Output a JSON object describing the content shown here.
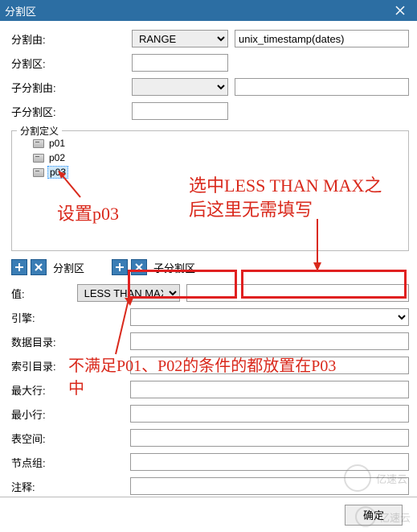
{
  "title": "分割区",
  "top_form": {
    "partition_by_label": "分割由:",
    "partition_by_value": "RANGE",
    "partition_expr": "unix_timestamp(dates)",
    "partition_zone_label": "分割区:",
    "partition_zone_value": "",
    "sub_partition_by_label": "子分割由:",
    "sub_partition_by_value": "",
    "sub_partition_expr": "",
    "sub_partition_zone_label": "子分割区:",
    "sub_partition_zone_value": ""
  },
  "definition_legend": "分割定义",
  "tree_items": [
    {
      "label": "p01",
      "selected": false
    },
    {
      "label": "p02",
      "selected": false
    },
    {
      "label": "p03",
      "selected": true
    }
  ],
  "annotations": {
    "a1": "设置p03",
    "a2": "选中LESS THAN MAX之后这里无需填写",
    "a3": "不满足P01、P02的条件的都放置在P03中"
  },
  "icons_row": {
    "section1_label": "分割区",
    "section2_label": "子分割区"
  },
  "detail_form": {
    "value_label": "值:",
    "value_select": "LESS THAN MAX",
    "value_extra": "",
    "engine_label": "引擎:",
    "engine_value": "",
    "data_dir_label": "数据目录:",
    "data_dir_value": "",
    "index_dir_label": "索引目录:",
    "index_dir_value": "",
    "max_rows_label": "最大行:",
    "max_rows_value": "",
    "min_rows_label": "最小行:",
    "min_rows_value": "",
    "tablespace_label": "表空间:",
    "tablespace_value": "",
    "nodegroup_label": "节点组:",
    "nodegroup_value": "",
    "comment_label": "注释:",
    "comment_value": ""
  },
  "buttons": {
    "ok": "确定"
  },
  "watermark": "亿速云"
}
